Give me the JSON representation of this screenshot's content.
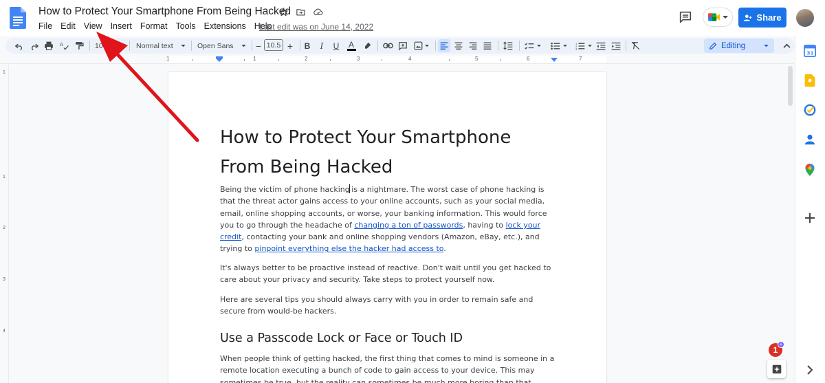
{
  "document": {
    "title": "How to Protect Your Smartphone From Being Hacked",
    "last_edit": "Last edit was on June 14, 2022",
    "heading1": "How to Protect Your Smartphone From Being Hacked",
    "para1": {
      "t1": "Being the victim of phone hacking",
      "t2": " is a nightmare. The worst case of phone hacking is that the threat actor gains access to your online accounts, such as your social media, email, online shopping accounts, or worse, your banking information. This would force you to go through the headache of ",
      "link1": "changing a ton of passwords",
      "t3": ", having to ",
      "link2": "lock your credit",
      "t4": ", contacting your bank and online shopping vendors (Amazon, eBay, etc.), and trying to ",
      "link3": "pinpoint everything else the hacker had access to",
      "t5": "."
    },
    "para2": "It's always better to be proactive instead of reactive. Don't wait until you get hacked to care about your privacy and security. Take steps to protect yourself now.",
    "para3": "Here are several tips you should always carry with you in order to remain safe and secure from would-be hackers.",
    "heading2": "Use a Passcode Lock or Face or Touch ID",
    "para4": "When people think of getting hacked, the first thing that comes to mind is someone in a remote location executing a bunch of code to gain access to your device. This may sometimes be true, but the reality can sometimes be much more boring than that. Hacking simply means someone"
  },
  "menu": [
    "File",
    "Edit",
    "View",
    "Insert",
    "Format",
    "Tools",
    "Extensions",
    "Help"
  ],
  "header": {
    "share_label": "Share"
  },
  "toolbar": {
    "zoom": "100%",
    "style": "Normal text",
    "font": "Open Sans",
    "font_size": "10.5",
    "mode": "Editing"
  },
  "ruler": [
    "1",
    "1",
    "2",
    "3",
    "4",
    "5",
    "6",
    "7"
  ],
  "vruler": [
    "1",
    "1",
    "2",
    "3",
    "4"
  ],
  "notifications": {
    "count": "1"
  },
  "colors": {
    "accent": "#1a73e8",
    "link": "#1155cc",
    "annotation": "#e0141b"
  },
  "icons": [
    "docs-logo",
    "star-icon",
    "folder-move-icon",
    "cloud-saved-icon",
    "comment-icon",
    "meet-icon",
    "person-icon",
    "undo-icon",
    "redo-icon",
    "print-icon",
    "spellcheck-icon",
    "paint-format-icon",
    "bold-icon",
    "italic-icon",
    "underline-icon",
    "text-color-icon",
    "highlight-icon",
    "link-icon",
    "add-comment-icon",
    "insert-image-icon",
    "align-left-icon",
    "align-center-icon",
    "align-right-icon",
    "justify-icon",
    "line-spacing-icon",
    "checklist-icon",
    "bulleted-list-icon",
    "numbered-list-icon",
    "decrease-indent-icon",
    "increase-indent-icon",
    "clear-formatting-icon",
    "pencil-icon",
    "chevron-up-icon",
    "calendar-icon",
    "keep-icon",
    "tasks-icon",
    "contacts-icon",
    "maps-icon",
    "plus-icon",
    "explore-icon",
    "chevron-right-icon"
  ]
}
